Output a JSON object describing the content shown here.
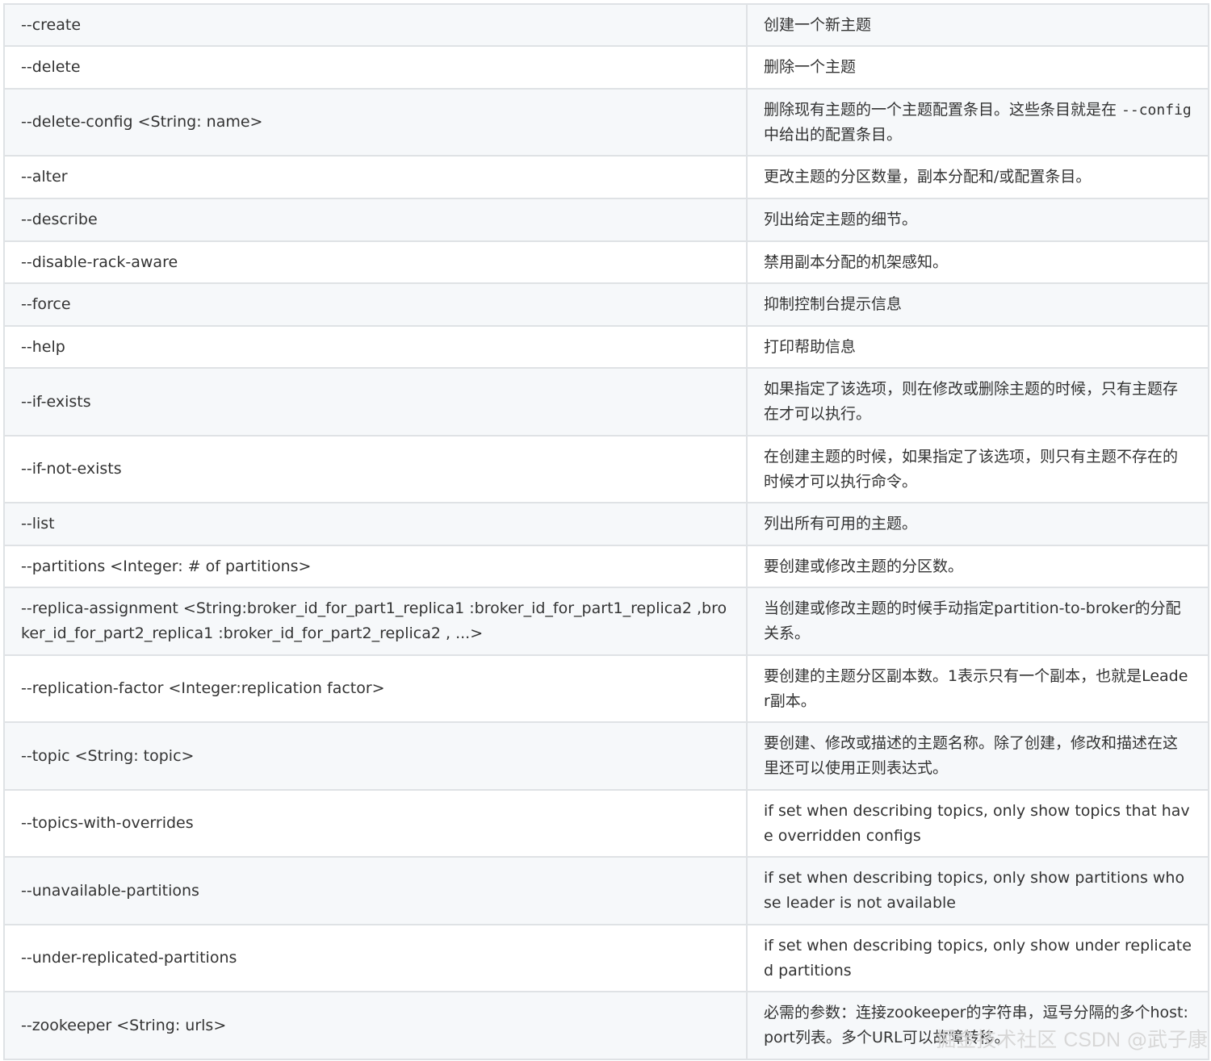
{
  "rows": [
    {
      "option": "--create",
      "desc": "创建一个新主题"
    },
    {
      "option": "--delete",
      "desc": "删除一个主题"
    },
    {
      "option": "--delete-config <String: name>",
      "desc_before": "删除现有主题的一个主题配置条目。这些条目就是在 ",
      "desc_code": "--config",
      "desc_after": " 中给出的配置条目。"
    },
    {
      "option": "--alter",
      "desc": "更改主题的分区数量，副本分配和/或配置条目。"
    },
    {
      "option": "--describe",
      "desc": "列出给定主题的细节。"
    },
    {
      "option": "--disable-rack-aware",
      "desc": "禁用副本分配的机架感知。"
    },
    {
      "option": "--force",
      "desc": "抑制控制台提示信息"
    },
    {
      "option": "--help",
      "desc": "打印帮助信息"
    },
    {
      "option": "--if-exists",
      "desc": "如果指定了该选项，则在修改或删除主题的时候，只有主题存在才可以执行。"
    },
    {
      "option": "--if-not-exists",
      "desc": "在创建主题的时候，如果指定了该选项，则只有主题不存在的时候才可以执行命令。"
    },
    {
      "option": "--list",
      "desc": "列出所有可用的主题。"
    },
    {
      "option": "--partitions <Integer: # of partitions>",
      "desc": "要创建或修改主题的分区数。"
    },
    {
      "option": "--replica-assignment <String:broker_id_for_part1_replica1 :broker_id_for_part1_replica2 ,broker_id_for_part2_replica1 :broker_id_for_part2_replica2 , ...>",
      "desc": "当创建或修改主题的时候手动指定partition-to-broker的分配关系。"
    },
    {
      "option": "--replication-factor <Integer:replication factor>",
      "desc": "要创建的主题分区副本数。1表示只有一个副本，也就是Leader副本。"
    },
    {
      "option": "--topic <String: topic>",
      "desc": "要创建、修改或描述的主题名称。除了创建，修改和描述在这里还可以使用正则表达式。"
    },
    {
      "option": "--topics-with-overrides",
      "desc": "if set when describing topics, only show topics that have overridden configs"
    },
    {
      "option": "--unavailable-partitions",
      "desc": "if set when describing topics, only show partitions whose leader is not available"
    },
    {
      "option": "--under-replicated-partitions",
      "desc": "if set when describing topics, only show under replicated partitions"
    },
    {
      "option": "--zookeeper <String: urls>",
      "desc": "必需的参数：连接zookeeper的字符串，逗号分隔的多个host:port列表。多个URL可以故障转移。"
    }
  ],
  "watermark": {
    "site": "掘金技术社区",
    "brand": "CSDN",
    "author": "@武子康"
  }
}
